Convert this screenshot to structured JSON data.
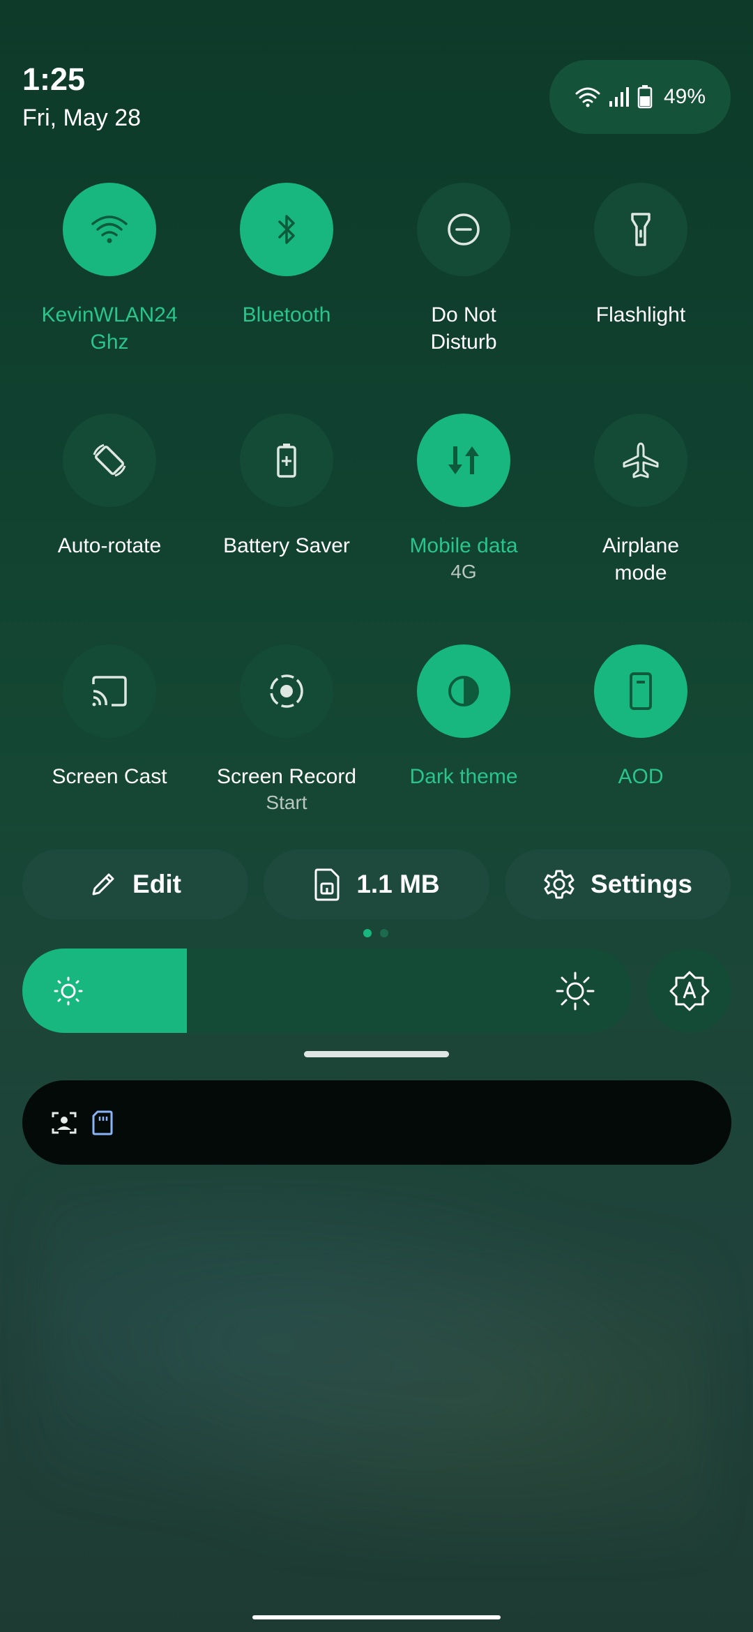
{
  "status": {
    "time": "1:25",
    "date": "Fri, May 28",
    "battery": "49%"
  },
  "tiles": [
    {
      "label": "KevinWLAN24 Ghz",
      "label_l1": "KevinWLAN24",
      "label_l2": "Ghz",
      "sub": "",
      "on": true,
      "icon": "wifi-icon"
    },
    {
      "label": "Bluetooth",
      "sub": "",
      "on": true,
      "icon": "bluetooth-icon"
    },
    {
      "label": "Do Not Disturb",
      "label_l1": "Do Not",
      "label_l2": "Disturb",
      "sub": "",
      "on": false,
      "icon": "do-not-disturb-icon"
    },
    {
      "label": "Flashlight",
      "sub": "",
      "on": false,
      "icon": "flashlight-icon"
    },
    {
      "label": "Auto-rotate",
      "sub": "",
      "on": false,
      "icon": "auto-rotate-icon"
    },
    {
      "label": "Battery Saver",
      "sub": "",
      "on": false,
      "icon": "battery-saver-icon"
    },
    {
      "label": "Mobile data",
      "sub": "4G",
      "on": true,
      "icon": "mobile-data-icon"
    },
    {
      "label": "Airplane mode",
      "label_l1": "Airplane",
      "label_l2": "mode",
      "sub": "",
      "on": false,
      "icon": "airplane-icon"
    },
    {
      "label": "Screen Cast",
      "sub": "",
      "on": false,
      "icon": "screen-cast-icon"
    },
    {
      "label": "Screen Record",
      "sub": "Start",
      "on": false,
      "icon": "screen-record-icon"
    },
    {
      "label": "Dark theme",
      "sub": "",
      "on": true,
      "icon": "dark-theme-icon"
    },
    {
      "label": "AOD",
      "sub": "",
      "on": true,
      "icon": "aod-icon"
    }
  ],
  "buttons": {
    "edit": "Edit",
    "data_usage": "1.1 MB",
    "settings": "Settings"
  },
  "pager": {
    "pages": 2,
    "current": 1
  },
  "brightness": {
    "level": 0.27
  },
  "notification_icons": [
    "face-scan-icon",
    "sd-card-icon"
  ],
  "colors": {
    "accent": "#17b77f",
    "tile_off": "#144b36",
    "accent_text": "#2ac48d"
  }
}
